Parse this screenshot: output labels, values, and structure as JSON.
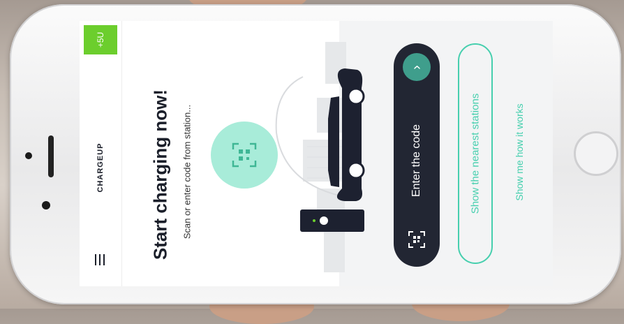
{
  "app": {
    "brand": "CHARGEUP",
    "credit_badge": "+5U"
  },
  "hero": {
    "headline": "Start charging now!",
    "subline": "Scan or enter code from station..."
  },
  "actions": {
    "enter_code_label": "Enter the code",
    "nearest_stations_label": "Show the nearest stations",
    "how_it_works_label": "Show me how it works"
  },
  "icons": {
    "menu": "hamburger-menu-icon",
    "scan": "qr-scan-icon",
    "arrow": "chevron-right-icon",
    "enter_qr": "qr-frame-icon",
    "car": "car-illustration",
    "charger": "charging-station-illustration"
  },
  "colors": {
    "accent_green": "#6cce2d",
    "mint": "#46cfae",
    "mint_light": "#a8ecd9",
    "dark": "#222633",
    "teal_button": "#3f9e8c"
  }
}
